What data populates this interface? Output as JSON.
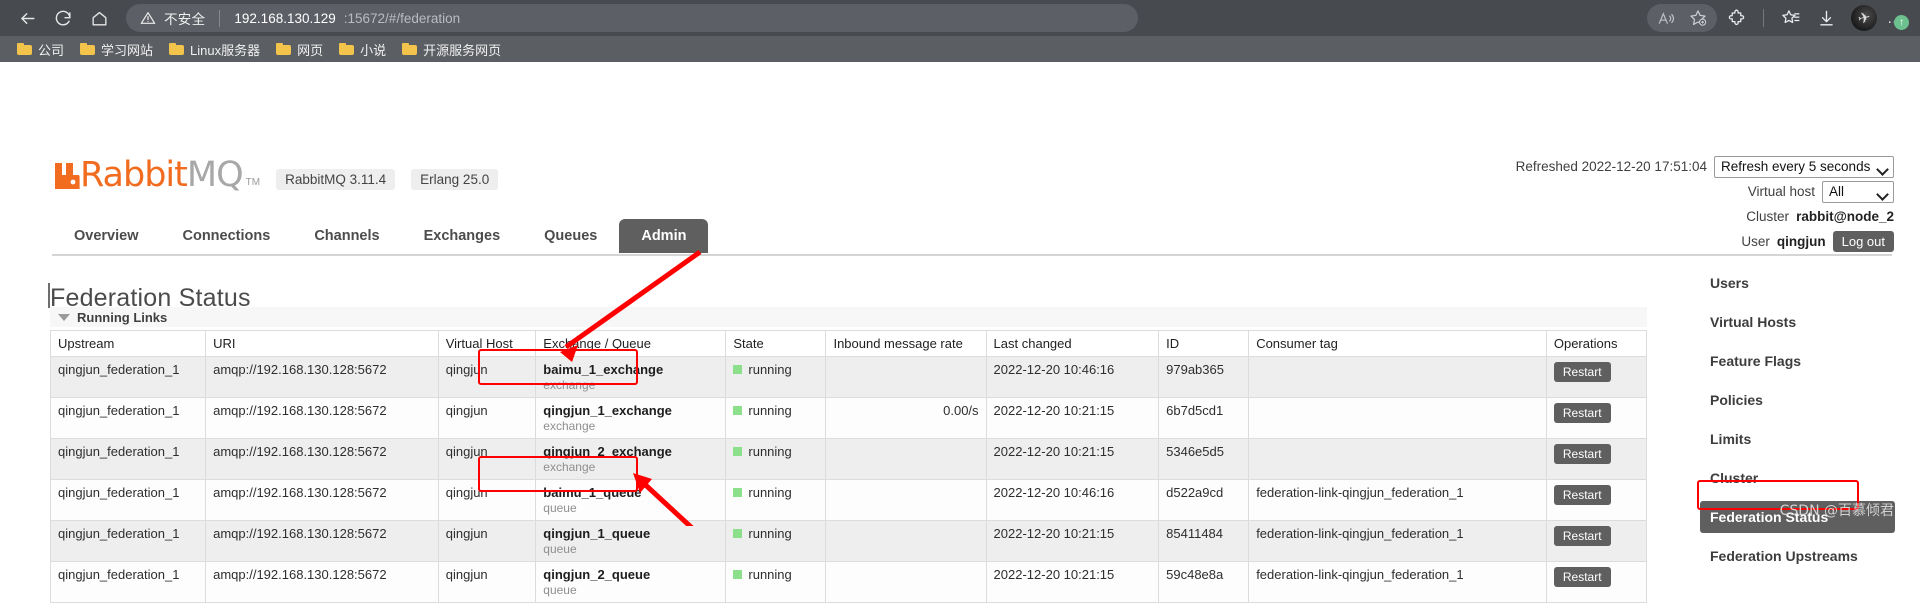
{
  "browser": {
    "nav": {
      "back": "back-arrow",
      "reload": "reload",
      "home": "home"
    },
    "omnibox": {
      "security_label": "不安全",
      "url_host": "192.168.130.129",
      "url_rest": ":15672/#/federation"
    },
    "toolbar_icons": [
      "read-aloud-icon",
      "add-favorite-icon",
      "extensions-icon",
      "collections-icon",
      "downloads-icon"
    ],
    "profile": "avatar",
    "more": "…",
    "update_badge": "↑",
    "bookmarks": [
      {
        "label": "公司"
      },
      {
        "label": "学习网站"
      },
      {
        "label": "Linux服务器"
      },
      {
        "label": "网页"
      },
      {
        "label": "小说"
      },
      {
        "label": "开源服务网页"
      }
    ]
  },
  "app": {
    "logo_primary": "Rabbit",
    "logo_secondary": "MQ",
    "logo_tm": "TM",
    "version_pill": "RabbitMQ 3.11.4",
    "erlang_pill": "Erlang 25.0"
  },
  "status": {
    "refreshed_label": "Refreshed 2022-12-20 17:51:04",
    "refresh_select": "Refresh every 5 seconds",
    "vhost_label": "Virtual host",
    "vhost_select": "All",
    "cluster_label": "Cluster",
    "cluster_value": "rabbit@node_2",
    "user_label": "User",
    "user_value": "qingjun",
    "logout_label": "Log out"
  },
  "tabs": [
    {
      "label": "Overview",
      "active": false
    },
    {
      "label": "Connections",
      "active": false
    },
    {
      "label": "Channels",
      "active": false
    },
    {
      "label": "Exchanges",
      "active": false
    },
    {
      "label": "Queues",
      "active": false
    },
    {
      "label": "Admin",
      "active": true
    }
  ],
  "page_title": "Federation Status",
  "section": {
    "title": "Running Links"
  },
  "table": {
    "columns": [
      "Upstream",
      "URI",
      "Virtual Host",
      "Exchange / Queue",
      "State",
      "Inbound message rate",
      "Last changed",
      "ID",
      "Consumer tag",
      "Operations"
    ],
    "rows": [
      {
        "upstream": "qingjun_federation_1",
        "uri": "amqp://192.168.130.128:5672",
        "vhost": "qingjun",
        "name": "baimu_1_exchange",
        "kind": "exchange",
        "state": "running",
        "rate": "",
        "last_changed": "2022-12-20 10:46:16",
        "id": "979ab365",
        "consumer_tag": "",
        "op": "Restart"
      },
      {
        "upstream": "qingjun_federation_1",
        "uri": "amqp://192.168.130.128:5672",
        "vhost": "qingjun",
        "name": "qingjun_1_exchange",
        "kind": "exchange",
        "state": "running",
        "rate": "0.00/s",
        "last_changed": "2022-12-20 10:21:15",
        "id": "6b7d5cd1",
        "consumer_tag": "",
        "op": "Restart"
      },
      {
        "upstream": "qingjun_federation_1",
        "uri": "amqp://192.168.130.128:5672",
        "vhost": "qingjun",
        "name": "qingjun_2_exchange",
        "kind": "exchange",
        "state": "running",
        "rate": "",
        "last_changed": "2022-12-20 10:21:15",
        "id": "5346e5d5",
        "consumer_tag": "",
        "op": "Restart"
      },
      {
        "upstream": "qingjun_federation_1",
        "uri": "amqp://192.168.130.128:5672",
        "vhost": "qingjun",
        "name": "baimu_1_queue",
        "kind": "queue",
        "state": "running",
        "rate": "",
        "last_changed": "2022-12-20 10:46:16",
        "id": "d522a9cd",
        "consumer_tag": "federation-link-qingjun_federation_1",
        "op": "Restart"
      },
      {
        "upstream": "qingjun_federation_1",
        "uri": "amqp://192.168.130.128:5672",
        "vhost": "qingjun",
        "name": "qingjun_1_queue",
        "kind": "queue",
        "state": "running",
        "rate": "",
        "last_changed": "2022-12-20 10:21:15",
        "id": "85411484",
        "consumer_tag": "federation-link-qingjun_federation_1",
        "op": "Restart"
      },
      {
        "upstream": "qingjun_federation_1",
        "uri": "amqp://192.168.130.128:5672",
        "vhost": "qingjun",
        "name": "qingjun_2_queue",
        "kind": "queue",
        "state": "running",
        "rate": "",
        "last_changed": "2022-12-20 10:21:15",
        "id": "59c48e8a",
        "consumer_tag": "federation-link-qingjun_federation_1",
        "op": "Restart"
      }
    ]
  },
  "right_menu": [
    {
      "label": "Users",
      "active": false
    },
    {
      "label": "Virtual Hosts",
      "active": false
    },
    {
      "label": "Feature Flags",
      "active": false
    },
    {
      "label": "Policies",
      "active": false
    },
    {
      "label": "Limits",
      "active": false
    },
    {
      "label": "Cluster",
      "active": false
    },
    {
      "label": "Federation Status",
      "active": true
    },
    {
      "label": "Federation Upstreams",
      "active": false
    }
  ],
  "watermark": "CSDN @百慕倾君",
  "colors": {
    "brand_orange": "#f26c20",
    "annotation_red": "#ff0000",
    "state_green": "#8ce08c",
    "active_gray": "#5f5f5f"
  }
}
